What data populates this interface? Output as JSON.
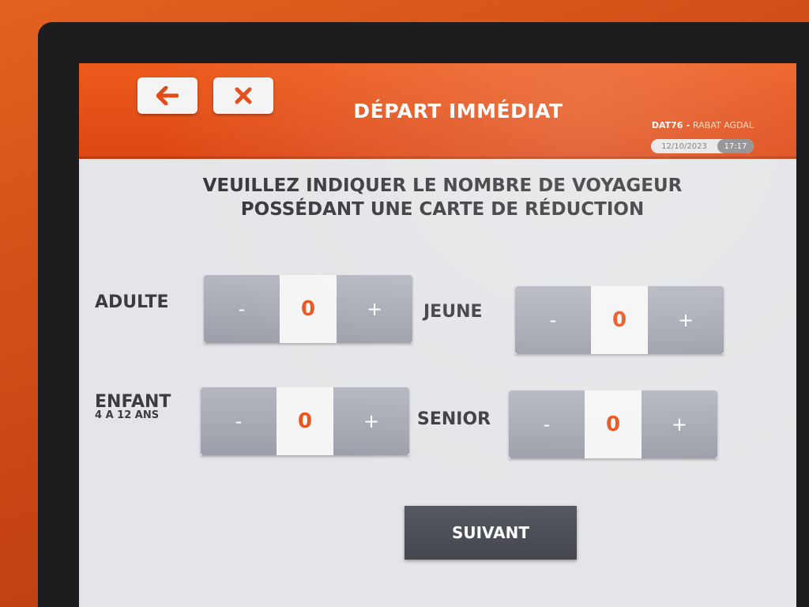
{
  "header": {
    "back_icon": "arrow-left-icon",
    "close_icon": "close-icon",
    "title": "DÉPART IMMÉDIAT",
    "station_code": "DAT76",
    "station_separator": "-",
    "station_name": "RABAT AGDAL",
    "date": "12/10/2023",
    "time": "17:17",
    "accent_color": "#e24a16"
  },
  "instruction": {
    "line1": "VEUILLEZ INDIQUER LE NOMBRE DE VOYAGEUR",
    "line2": "POSSÉDANT UNE CARTE DE RÉDUCTION"
  },
  "counters": {
    "adulte": {
      "label": "ADULTE",
      "minus": "-",
      "value": "0",
      "plus": "+"
    },
    "jeune": {
      "label": "JEUNE",
      "minus": "-",
      "value": "0",
      "plus": "+"
    },
    "enfant": {
      "label": "ENFANT",
      "sublabel": "4 A 12 ANS",
      "minus": "-",
      "value": "0",
      "plus": "+"
    },
    "senior": {
      "label": "SENIOR",
      "minus": "-",
      "value": "0",
      "plus": "+"
    }
  },
  "next_button": {
    "label": "SUIVANT"
  }
}
